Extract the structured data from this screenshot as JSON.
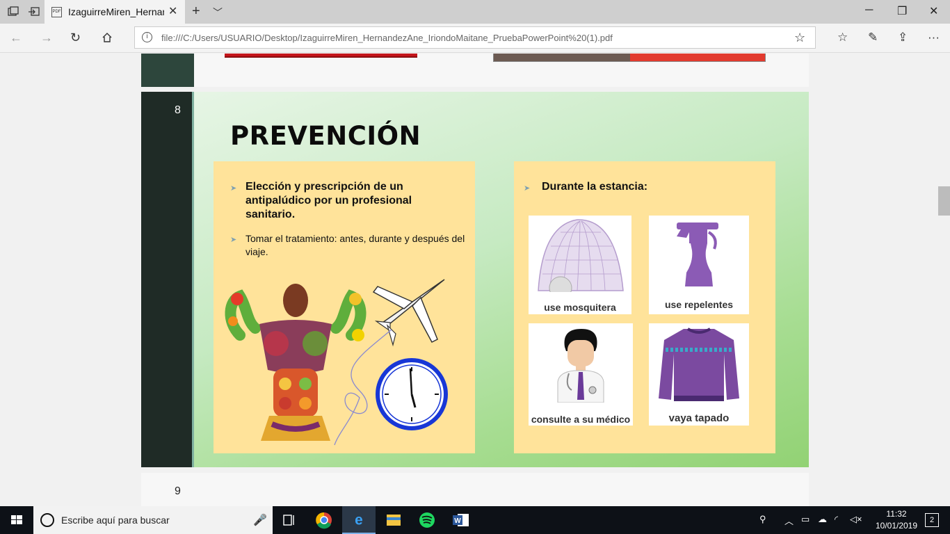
{
  "browser": {
    "tab_title": "IzaguirreMiren_HernandezAne_IriondoMaitane_PruebaPowerPoint",
    "tab_icon_label": "PDF",
    "url": "file:///C:/Users/USUARIO/Desktop/IzaguirreMiren_HernandezAne_IriondoMaitane_PruebaPowerPoint%20(1).pdf"
  },
  "slide": {
    "number": "8",
    "title": "PREVENCIÓN",
    "left_panel": {
      "bullet1": "Elección y prescripción de un antipalúdico por un profesional sanitario.",
      "bullet2": "Tomar el tratamiento: antes, durante y después del viaje."
    },
    "right_panel": {
      "heading": "Durante la estancia:",
      "tiles": [
        "use mosquitera",
        "use repelentes",
        "consulte a su médico",
        "vaya tapado"
      ]
    }
  },
  "next_slide": {
    "number": "9"
  },
  "taskbar": {
    "search_placeholder": "Escribe aquí para buscar",
    "time": "11:32",
    "date": "10/01/2019",
    "notifications": "2"
  },
  "colors": {
    "slide_sidebar": "#1f2b26",
    "panel": "#ffe39a",
    "purple": "#7b4aa0",
    "taskbar": "#0d1117"
  }
}
